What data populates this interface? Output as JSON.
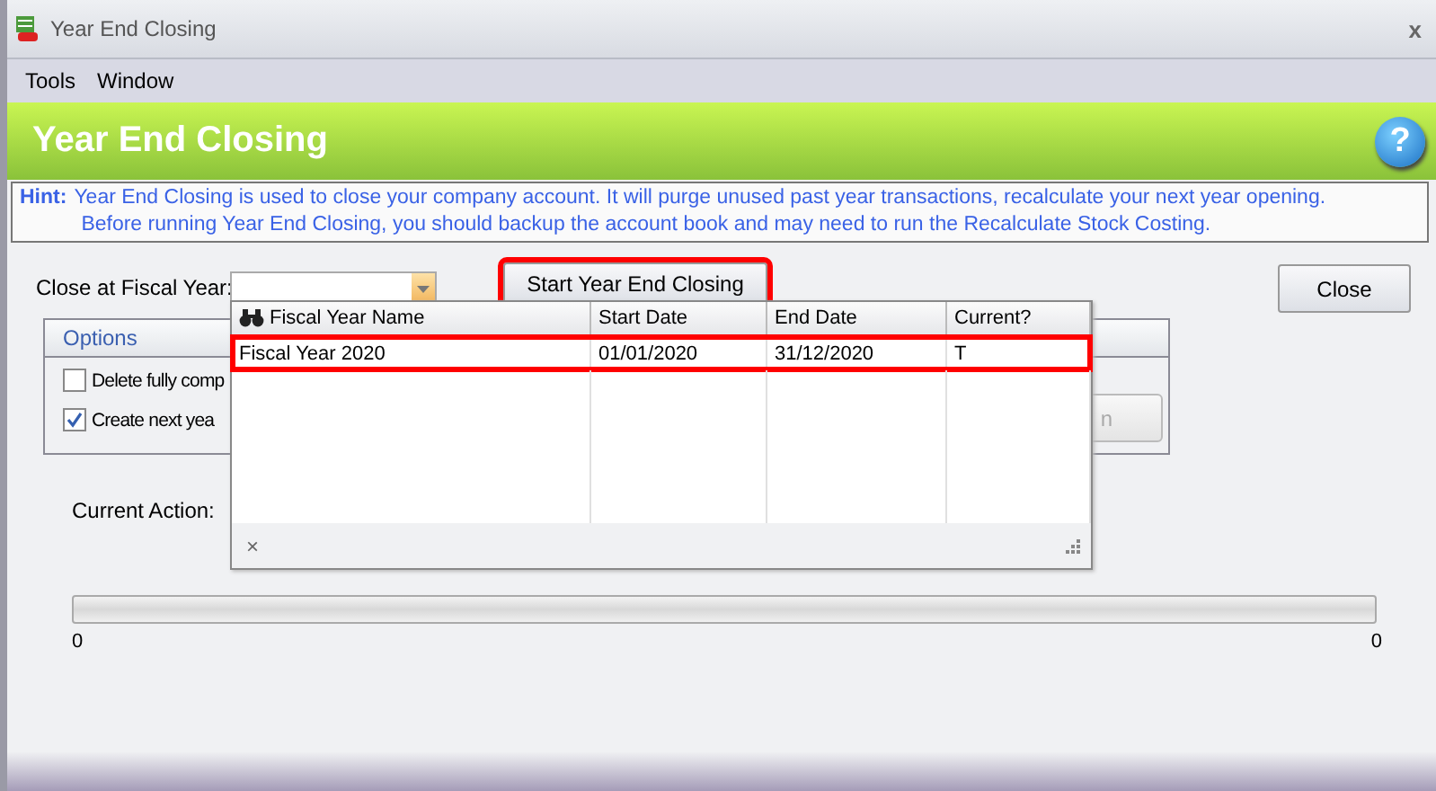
{
  "window": {
    "title": "Year End Closing",
    "close": "x"
  },
  "menu": [
    "Tools",
    "Window"
  ],
  "header": {
    "title": "Year End Closing",
    "help": "?"
  },
  "hint": {
    "label": "Hint:",
    "lines": [
      "Year End Closing is used to close your company account. It will purge unused past year transactions, recalculate your next year opening.",
      "Before running Year End Closing, you should backup the account book and may need to run the Recalculate Stock Costing."
    ]
  },
  "fiscal_year": {
    "label": "Close at Fiscal Year:"
  },
  "start_button": {
    "label": "Start Year End Closing",
    "highlighted": true
  },
  "close_button": {
    "label": "Close"
  },
  "options": {
    "title": "Options",
    "items": [
      {
        "label": "Delete fully comp",
        "checked": false
      },
      {
        "label": "Create next yea",
        "checked": true
      }
    ],
    "button": {
      "label": "n",
      "disabled": true
    }
  },
  "current_action": {
    "label": "Current Action:"
  },
  "progress": {
    "level": 0,
    "min": "0",
    "max": "0"
  },
  "dropdown": {
    "columns": [
      "Fiscal Year Name",
      "Start Date",
      "End Date",
      "Current?"
    ],
    "rows": [
      {
        "cells": [
          "Fiscal Year 2020",
          "01/01/2020",
          "31/12/2020",
          "T"
        ],
        "highlighted": true
      }
    ],
    "clear": "×"
  }
}
